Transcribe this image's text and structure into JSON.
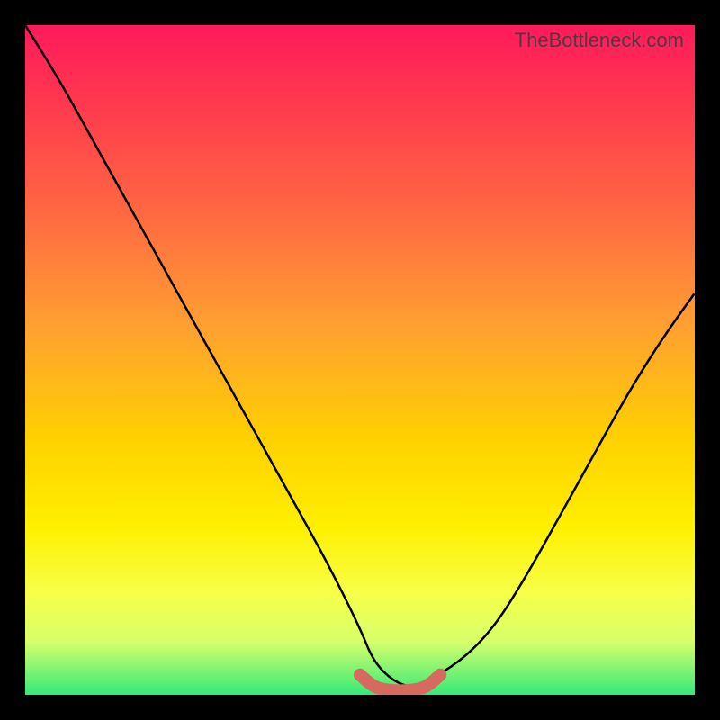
{
  "watermark": "TheBottleneck.com",
  "chart_data": {
    "type": "line",
    "title": "",
    "xlabel": "",
    "ylabel": "",
    "xlim": [
      0,
      100
    ],
    "ylim": [
      0,
      100
    ],
    "grid": false,
    "legend": false,
    "background_gradient": {
      "orientation": "vertical",
      "stops": [
        {
          "pos": 0.0,
          "color": "#ff1a5c"
        },
        {
          "pos": 0.28,
          "color": "#ff6842"
        },
        {
          "pos": 0.62,
          "color": "#ffd100"
        },
        {
          "pos": 0.85,
          "color": "#f6ff4a"
        },
        {
          "pos": 1.0,
          "color": "#34ea7a"
        }
      ]
    },
    "series": [
      {
        "name": "bottleneck-curve",
        "color": "#000000",
        "x": [
          0,
          5,
          10,
          15,
          20,
          25,
          30,
          35,
          40,
          45,
          50,
          52,
          55,
          58,
          60,
          65,
          70,
          75,
          80,
          85,
          90,
          95,
          100
        ],
        "y": [
          100,
          92,
          83,
          74,
          65,
          56,
          47,
          38,
          29,
          20,
          10,
          5,
          2,
          1,
          2,
          5,
          10,
          18,
          27,
          36,
          45,
          53,
          60
        ]
      },
      {
        "name": "optimal-range-marker",
        "color": "#d66a5f",
        "x": [
          50,
          52,
          54,
          56,
          58,
          60,
          62
        ],
        "y": [
          3,
          1.2,
          0.7,
          0.6,
          0.7,
          1.2,
          3
        ]
      }
    ],
    "annotations": []
  }
}
